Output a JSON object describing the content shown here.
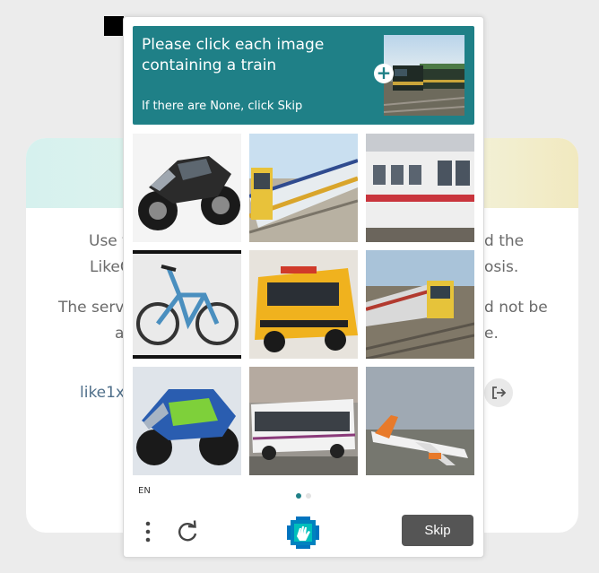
{
  "background_page": {
    "line1_left": "Use t",
    "line1_right": "d the",
    "line2_left": "LikeC",
    "line2_right": "osis.",
    "line3_left": "The serv",
    "line3_right": "d not be",
    "line4_left": "a",
    "line4_right": "e.",
    "link_text": "like1x"
  },
  "captcha": {
    "prompt": {
      "title": "Please click each image containing a train",
      "subtitle": "If there are None, click Skip",
      "add_symbol": "+"
    },
    "tiles": [
      {
        "subject": "motorcycle",
        "selected": false
      },
      {
        "subject": "train",
        "selected": false
      },
      {
        "subject": "train",
        "selected": false
      },
      {
        "subject": "bicycle",
        "selected": false
      },
      {
        "subject": "school-bus",
        "selected": false
      },
      {
        "subject": "train",
        "selected": false
      },
      {
        "subject": "motorcycle",
        "selected": false
      },
      {
        "subject": "bus",
        "selected": false
      },
      {
        "subject": "airplane",
        "selected": false
      }
    ],
    "language": "EN",
    "page_indicator": {
      "current": 1,
      "total": 2
    },
    "skip_label": "Skip",
    "accent_color": "#1f8087",
    "skip_color": "#555555"
  }
}
